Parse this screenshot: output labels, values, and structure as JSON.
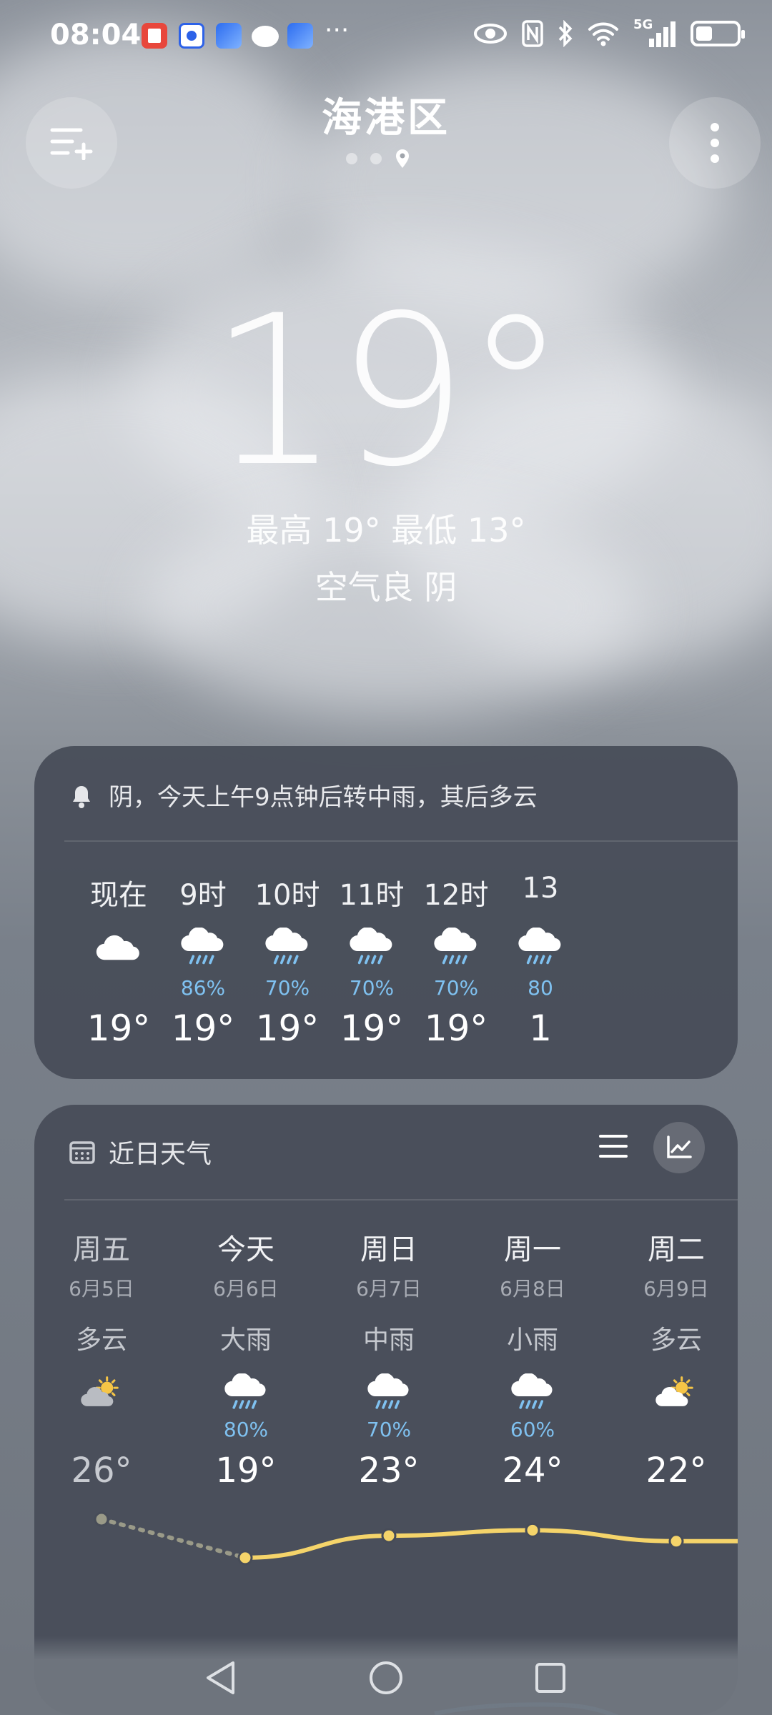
{
  "status_bar": {
    "time": "08:04",
    "network": "5G",
    "battery_level": 0.4,
    "app_icons": [
      "book-app-icon",
      "baidu-app-icon",
      "browser-app-icon",
      "message-app-icon",
      "browser-app-icon"
    ],
    "more": "···"
  },
  "header": {
    "city": "海港区",
    "page_count": 3,
    "current_page": 3
  },
  "current": {
    "temperature": "19°",
    "high_low": "最高 19° 最低 13°",
    "aqi_condition": "空气良 阴"
  },
  "hourly": {
    "alert": "阴，今天上午9点钟后转中雨，其后多云",
    "items": [
      {
        "time": "现在",
        "icon": "cloud-icon",
        "precip": "",
        "temp": "19°"
      },
      {
        "time": "9时",
        "icon": "rain-icon",
        "precip": "86%",
        "temp": "19°"
      },
      {
        "time": "10时",
        "icon": "rain-icon",
        "precip": "70%",
        "temp": "19°"
      },
      {
        "time": "11时",
        "icon": "rain-icon",
        "precip": "70%",
        "temp": "19°"
      },
      {
        "time": "12时",
        "icon": "rain-icon",
        "precip": "70%",
        "temp": "19°"
      },
      {
        "time": "13",
        "icon": "rain-icon",
        "precip": "80",
        "temp": "1"
      }
    ]
  },
  "daily": {
    "title": "近日天气",
    "items": [
      {
        "day": "周五",
        "date": "6月5日",
        "condition": "多云",
        "icon": "partly-cloudy-icon",
        "precip": "",
        "high": "26°"
      },
      {
        "day": "今天",
        "date": "6月6日",
        "condition": "大雨",
        "icon": "heavy-rain-icon",
        "precip": "80%",
        "high": "19°"
      },
      {
        "day": "周日",
        "date": "6月7日",
        "condition": "中雨",
        "icon": "moderate-rain-icon",
        "precip": "70%",
        "high": "23°"
      },
      {
        "day": "周一",
        "date": "6月8日",
        "condition": "小雨",
        "icon": "light-rain-icon",
        "precip": "60%",
        "high": "24°"
      },
      {
        "day": "周二",
        "date": "6月9日",
        "condition": "多云",
        "icon": "partly-cloudy-sun-icon",
        "precip": "",
        "high": "22°"
      }
    ],
    "high_trend": [
      26,
      19,
      23,
      24,
      22,
      22
    ],
    "colors": {
      "past_line": "#9a9a88",
      "high_line": "#f5d46a",
      "low_line": "#6fb9ef"
    }
  },
  "colors": {
    "precip_text": "#7fc1f0",
    "card_bg": "#474c58"
  }
}
